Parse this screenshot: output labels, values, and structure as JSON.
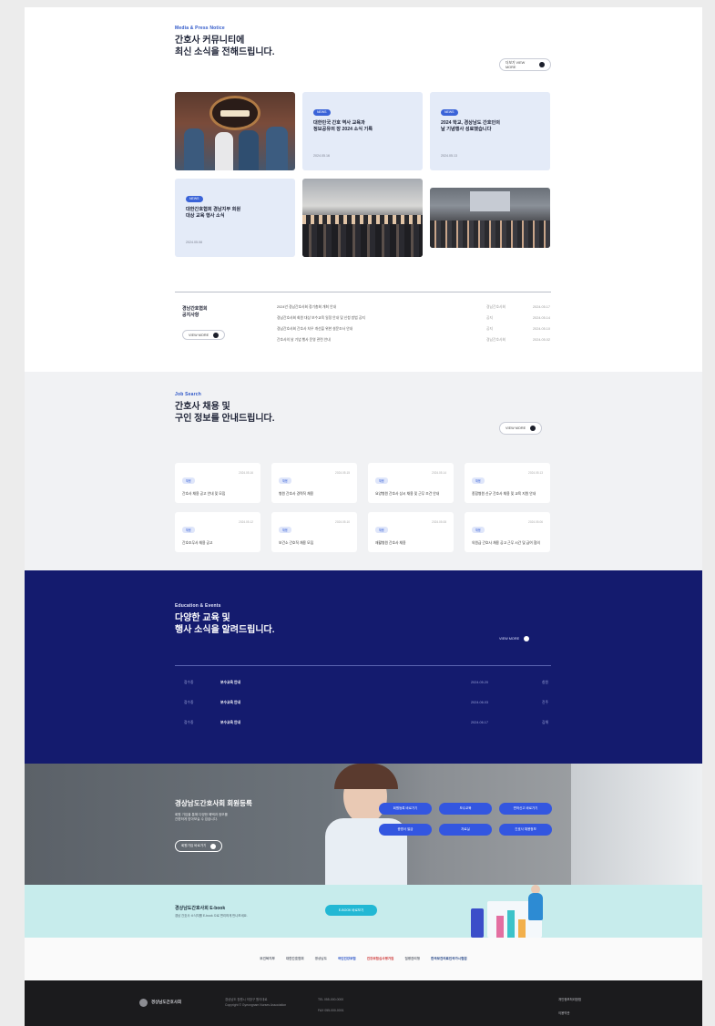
{
  "news": {
    "eyebrow": "Media & Press Notice",
    "title_line1": "간호사 커뮤니티에",
    "title_line2": "최신 소식을 전해드립니다.",
    "more_label": "더보기 VIEW MORE",
    "cards": [
      {
        "chip": "NEWS",
        "title": "대한민국 간호 역사 교육과\n정보공유의 장 2024 소식 기록",
        "date": "2024.05.16"
      },
      {
        "chip": "NEWS",
        "title": "2024 학교, 경상남도 간호인의\n날 기념행사 성료했습니다",
        "date": "2024.05.13"
      },
      {
        "chip": "NEWS",
        "title": "대한간호협회 경남지부 회원\n대상 교육 행사 소식",
        "date": "2024.05.08"
      }
    ]
  },
  "notice": {
    "title_line1": "경남간호협회",
    "title_line2": "공지사항",
    "more_label": "VIEW MORE",
    "rows": [
      {
        "title": "2024년 경남간호사회 정기총회 개최 안내",
        "cat": "경남간호사회",
        "date": "2024.05.17"
      },
      {
        "title": "경남간호사회 회원 대상 보수교육 일정 안내 및 신청 방법 공지",
        "cat": "공지",
        "date": "2024.05.14"
      },
      {
        "title": "경남간호사회 간호사 처우 개선을 위한 설문조사 안내",
        "cat": "공지",
        "date": "2024.05.10"
      },
      {
        "title": "간호사의 날 기념 행사 운영 관련 안내",
        "cat": "경남간호사회",
        "date": "2024.05.02"
      }
    ]
  },
  "jobs": {
    "eyebrow": "Job Search",
    "title_line1": "간호사 채용 및",
    "title_line2": "구인 정보를 안내드립니다.",
    "more_label": "VIEW MORE",
    "cards": [
      {
        "chip": "채용",
        "title": "간호사 채용 공고 안내 및 모집",
        "date": "2024.05.16"
      },
      {
        "chip": "채용",
        "title": "병원 간호사 경력직 채용",
        "date": "2024.05.15"
      },
      {
        "chip": "채용",
        "title": "요양병원 간호사 상시 채용 및 근무 조건 안내",
        "date": "2024.05.14"
      },
      {
        "chip": "채용",
        "title": "종합병원 신규 간호사 채용 및 교육 지원 안내",
        "date": "2024.05.13"
      },
      {
        "chip": "채용",
        "title": "간호조무사 채용 공고",
        "date": "2024.05.12"
      },
      {
        "chip": "채용",
        "title": "보건소 간호직 채용 모집",
        "date": "2024.05.10"
      },
      {
        "chip": "채용",
        "title": "재활병원 간호사 채용",
        "date": "2024.05.08"
      },
      {
        "chip": "채용",
        "title": "의원급 간호사 채용 공고 근무 시간 및 급여 협의",
        "date": "2024.05.06"
      }
    ]
  },
  "events": {
    "eyebrow": "Education & Events",
    "title_line1": "다양한 교육 및",
    "title_line2": "행사 소식을 알려드립니다.",
    "more_label": "VIEW MORE",
    "rows": [
      {
        "status": "접수중",
        "title": "보수교육 안내",
        "date": "2024.05.20",
        "place": "창원"
      },
      {
        "status": "접수중",
        "title": "보수교육 안내",
        "date": "2024.06.03",
        "place": "진주"
      },
      {
        "status": "접수중",
        "title": "보수교육 안내",
        "date": "2024.06.17",
        "place": "김해"
      }
    ]
  },
  "hero": {
    "title": "경상남도간호사회 회원등록",
    "desc_line1": "회원 가입을 통해 다양한 혜택과 정보를",
    "desc_line2": "간편하게 받아보실 수 있습니다.",
    "cta_label": "회원가입 바로가기",
    "quick_links": [
      "회원등록 바로가기",
      "보수교육",
      "면허신고 바로가기",
      "증명서 발급",
      "자료실",
      "간호사 채용정보"
    ]
  },
  "book": {
    "title": "경상남도간호사회 E-book",
    "desc": "경남 간호사 소식지를 E-book 으로 편리하게 만나보세요.",
    "button_label": "E-BOOK 바로보기"
  },
  "partners": [
    "보건복지부",
    "대한간호협회",
    "경상남도",
    "국민건강보험",
    "건강보험심사평가원",
    "질병관리청",
    "한국보건의료인국가시험원"
  ],
  "footer": {
    "logo_text": "경상남도간호사회",
    "address_line1": "경상남도 창원시 의창구 원이대로",
    "address_line2": "Copyright © Gyeongnam Nurses Association",
    "tel_line1": "TEL 055-000-0000",
    "tel_line2": "FAX 055-000-0001",
    "link1": "개인정보처리방침",
    "link2": "이용약관"
  },
  "colors": {
    "accent": "#2d56c8",
    "navy": "#141b6e",
    "mint": "#c7ecec",
    "footer": "#1b1b1d"
  }
}
